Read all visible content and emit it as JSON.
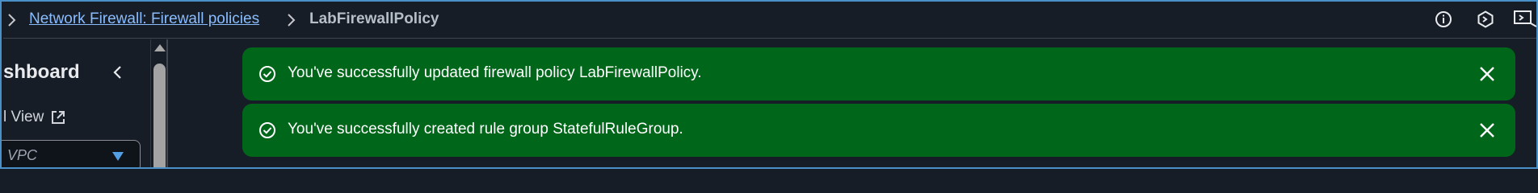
{
  "breadcrumb": {
    "parent_link": "Network Firewall: Firewall policies",
    "current": "LabFirewallPolicy"
  },
  "top_icons": [
    "info-icon",
    "cloudshell-hexagon-icon",
    "screen-feedback-icon"
  ],
  "sidenav": {
    "title": "shboard",
    "link": "l View",
    "select_value": "VPC"
  },
  "notifications": [
    {
      "type": "success",
      "message": "You've successfully updated firewall policy LabFirewallPolicy."
    },
    {
      "type": "success",
      "message": "You've successfully created rule group StatefulRuleGroup."
    }
  ],
  "colors": {
    "success": "#00661a",
    "link": "#89bdff",
    "background": "#161d26",
    "accent": "#539fe5"
  }
}
